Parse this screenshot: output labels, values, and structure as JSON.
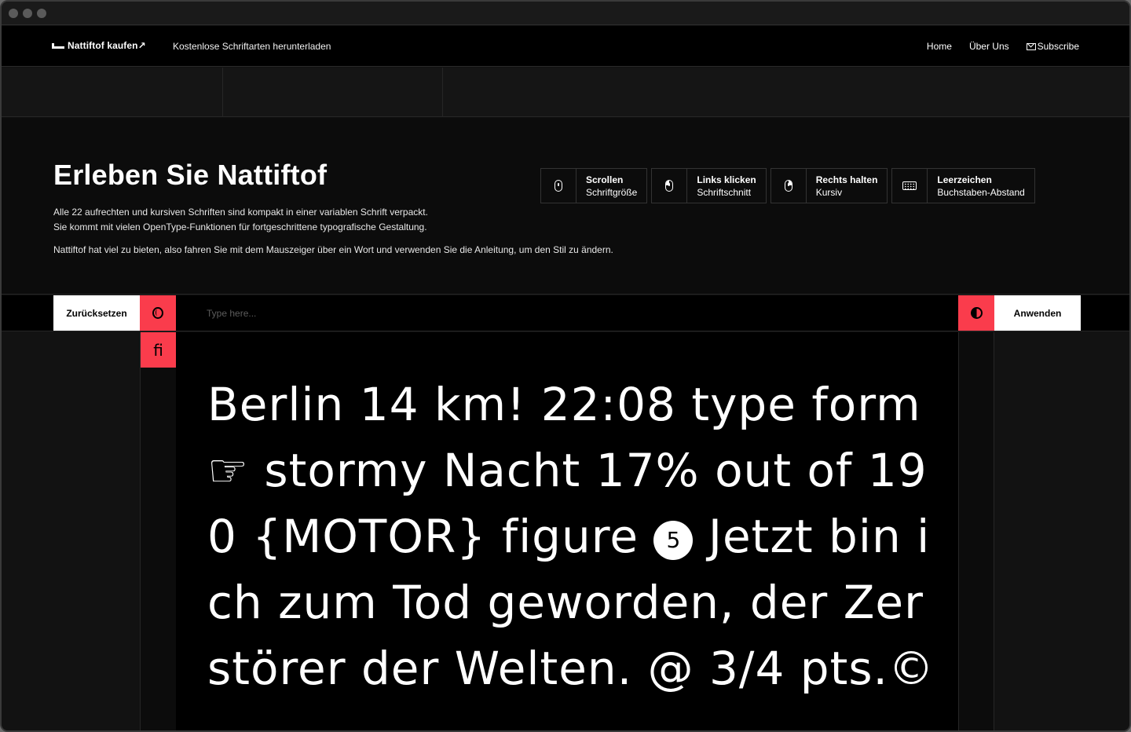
{
  "nav": {
    "brand": "Nattiftof kaufen↗",
    "tagline": "Kostenlose Schriftarten herunterladen",
    "links": [
      "Home",
      "Über Uns"
    ],
    "subscribe": "Subscribe"
  },
  "hero": {
    "title": "Erleben Sie Nattiftof",
    "line1": "Alle 22 aufrechten und kursiven Schriften sind kompakt in einer variablen Schrift verpackt.",
    "line2": "Sie kommt mit vielen OpenType-Funktionen für fortgeschrittene typografische Gestaltung.",
    "line3": "Nattiftof hat viel zu bieten, also fahren Sie mit dem Mauszeiger über ein Wort und verwenden Sie die Anleitung, um den Stil zu ändern."
  },
  "hints": [
    {
      "icon": "mouse-scroll-icon",
      "action": "Scrollen",
      "effect": "Schriftgröße"
    },
    {
      "icon": "mouse-left-click-icon",
      "action": "Links klicken",
      "effect": "Schriftschnitt"
    },
    {
      "icon": "mouse-right-click-icon",
      "action": "Rechts halten",
      "effect": "Kursiv"
    },
    {
      "icon": "keyboard-icon",
      "action": "Leerzeichen",
      "effect": "Buchstaben-Abstand"
    }
  ],
  "toolbar": {
    "reset": "Zurücksetzen",
    "placeholder": "Type here...",
    "apply": "Anwenden",
    "ligature": "ﬁ"
  },
  "specimen": {
    "before": "Berlin 14 km! 22:08 type form ☞ stormy Nacht 17% out of 190 {MOTOR} figure ",
    "circled": "5",
    "after": " Jetzt bin ich zum Tod geworden, der Zerstörer der Welten. @ 3/4 pts.©"
  },
  "colors": {
    "accent": "#fa3c4c",
    "background": "#000000",
    "text": "#ffffff"
  }
}
